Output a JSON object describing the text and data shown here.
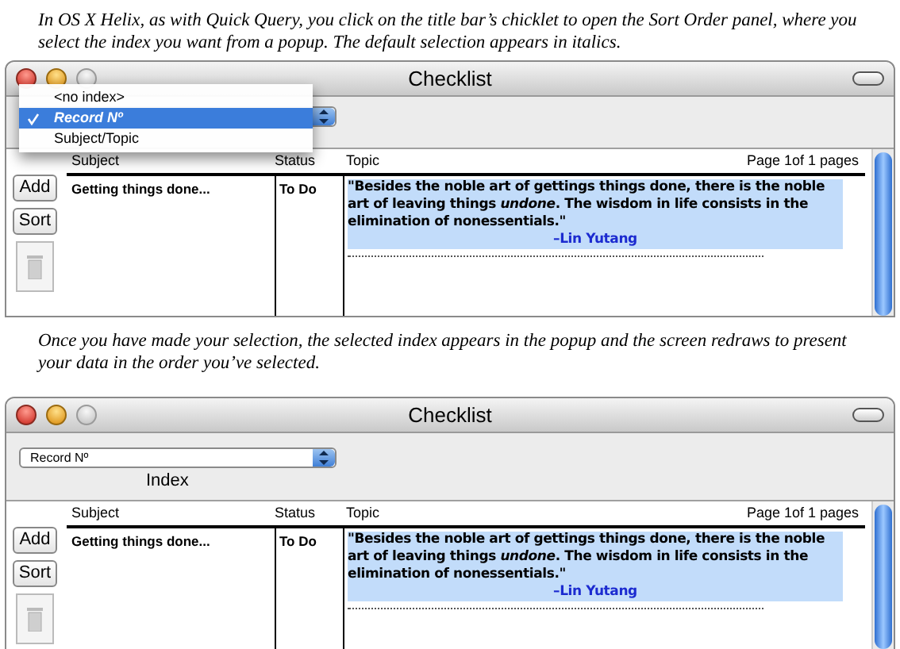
{
  "sections": [
    {
      "intro": "In OS X Helix, as with Quick Query, you click on the title bar’s chicklet to open the Sort Order panel, where you select the index you want from a popup. The default selection appears in italics.",
      "window": {
        "title": "Checklist",
        "menu": {
          "items": [
            {
              "label": "<no index>",
              "selected": false,
              "default": false
            },
            {
              "label": "Record Nº",
              "selected": true,
              "default": true
            },
            {
              "label": "Subject/Topic",
              "selected": false,
              "default": false
            }
          ]
        },
        "buttons": [
          "Add",
          "Sort"
        ],
        "columns": [
          "Subject",
          "Status",
          "Topic"
        ],
        "page_info": "Page 1of 1 pages",
        "rows": [
          {
            "subject": "Getting things done...",
            "status": "To Do",
            "quote": "\"Besides the noble art of gettings things done, there is the noble art of leaving things *undone*. The wisdom in life consists in the elimination of nonessentials.\"",
            "attribution": "–Lin Yutang"
          }
        ]
      }
    },
    {
      "intro": "Once you have made your selection, the selected index appears in the popup and the screen redraws to present your data in the order you’ve selected.",
      "window": {
        "title": "Checklist",
        "popup": {
          "value": "Record Nº",
          "label": "Index"
        },
        "buttons": [
          "Add",
          "Sort"
        ],
        "columns": [
          "Subject",
          "Status",
          "Topic"
        ],
        "page_info": "Page 1of 1 pages",
        "rows": [
          {
            "subject": "Getting things done...",
            "status": "To Do",
            "quote": "\"Besides the noble art of gettings things done, there is the noble art of leaving things *undone*. The wisdom in life consists in the elimination of nonessentials.\"",
            "attribution": "–Lin Yutang"
          }
        ]
      }
    }
  ]
}
